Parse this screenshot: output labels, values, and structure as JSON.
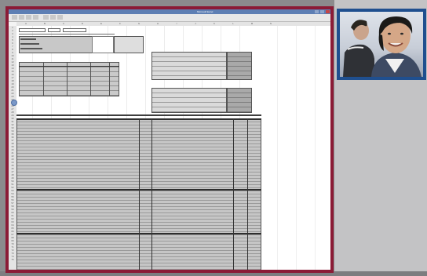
{
  "window": {
    "title": "Microsoft Excel",
    "accent_colors": {
      "main_border": "#8b1b36",
      "camera_border": "#1f4f8f",
      "titlebar": "#5e7fb4"
    }
  },
  "spreadsheet": {
    "column_headers": [
      "A",
      "B",
      "C",
      "D",
      "E",
      "F",
      "G",
      "H",
      "I",
      "J",
      "K",
      "L",
      "M",
      "N"
    ],
    "row_numbers": [
      "1",
      "2",
      "3",
      "4",
      "5",
      "6",
      "7",
      "8",
      "9",
      "10",
      "11",
      "12",
      "13",
      "14",
      "15",
      "16",
      "17",
      "18",
      "19",
      "20",
      "21",
      "22",
      "23",
      "24",
      "25",
      "26",
      "27",
      "28",
      "29",
      "30",
      "31",
      "32",
      "33",
      "34",
      "35",
      "36",
      "37",
      "38",
      "39",
      "40",
      "41",
      "42",
      "43",
      "44",
      "45",
      "46",
      "47",
      "48",
      "49",
      "50",
      "51",
      "52",
      "53",
      "54",
      "55",
      "56",
      "57",
      "58",
      "59",
      "60",
      "61",
      "62",
      "63",
      "64",
      "65",
      "66",
      "67",
      "68",
      "69",
      "70",
      "71",
      "72",
      "73",
      "74",
      "75"
    ]
  },
  "webcam": {
    "icon": "person-video-icon"
  }
}
